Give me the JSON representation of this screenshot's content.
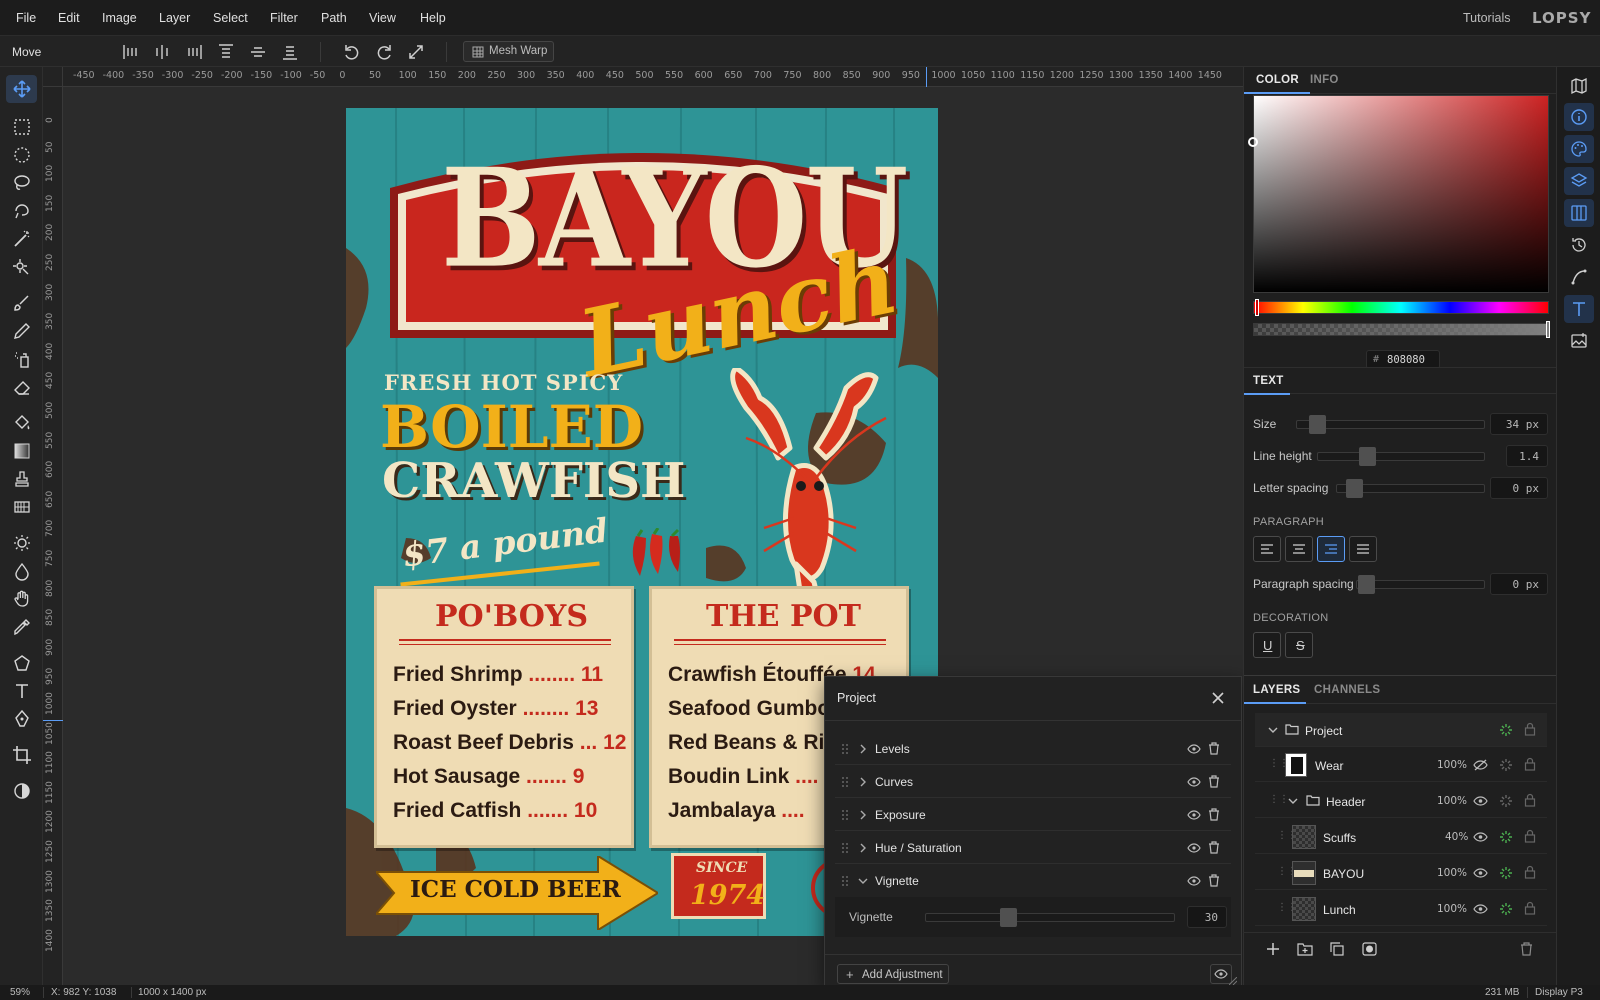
{
  "menubar": {
    "items": [
      "File",
      "Edit",
      "Image",
      "Layer",
      "Select",
      "Filter",
      "Path",
      "View",
      "Help"
    ],
    "tutorials": "Tutorials",
    "logo": "LOPSY"
  },
  "toolbar": {
    "tool_name": "Move",
    "mesh_warp": "Mesh Warp"
  },
  "rulers": {
    "top": [
      "-450",
      "-400",
      "-350",
      "-300",
      "-250",
      "-200",
      "-150",
      "-100",
      "-50",
      "0",
      "50",
      "100",
      "150",
      "200",
      "250",
      "300",
      "350",
      "400",
      "450",
      "500",
      "550",
      "600",
      "650",
      "700",
      "750",
      "800",
      "850",
      "900",
      "950",
      "1000",
      "1050",
      "1100",
      "1150",
      "1200",
      "1250",
      "1300",
      "1350",
      "1400",
      "1450"
    ],
    "left": [
      "0",
      "50",
      "100",
      "150",
      "200",
      "250",
      "300",
      "350",
      "400",
      "450",
      "500",
      "550",
      "600",
      "650",
      "700",
      "750",
      "800",
      "850",
      "900",
      "950",
      "1000",
      "1050",
      "1100",
      "1150",
      "1200",
      "1250",
      "1300",
      "1350",
      "1400"
    ]
  },
  "poster": {
    "title": "BAYOU",
    "subtitle": "Lunch",
    "tagline": "FRESH HOT SPICY",
    "headline1": "BOILED",
    "headline2": "CRAWFISH",
    "price": "$7 a pound",
    "poboys": {
      "title": "PO'BOYS",
      "items": [
        {
          "name": "Fried Shrimp",
          "dots": "........",
          "price": "11"
        },
        {
          "name": "Fried Oyster",
          "dots": "........",
          "price": "13"
        },
        {
          "name": "Roast Beef Debris",
          "dots": "...",
          "price": "12"
        },
        {
          "name": "Hot Sausage",
          "dots": ".......",
          "price": "9"
        },
        {
          "name": "Fried Catfish",
          "dots": ".......",
          "price": "10"
        }
      ]
    },
    "pot": {
      "title": "THE POT",
      "items": [
        {
          "name": "Crawfish Étouffée",
          "price": "14"
        },
        {
          "name": "Seafood Gumbo",
          "price": ""
        },
        {
          "name": "Red Beans & Rice",
          "price": ""
        },
        {
          "name": "Boudin Link",
          "dots": "....",
          "price": ""
        },
        {
          "name": "Jambalaya",
          "dots": "....",
          "price": ""
        }
      ]
    },
    "beer": "ICE COLD BEER",
    "since_label": "SINCE",
    "since_year": "1974"
  },
  "color_panel": {
    "tabs": [
      "COLOR",
      "INFO"
    ],
    "hex_prefix": "#",
    "hex": "808080",
    "hue_base": "#cc2222"
  },
  "text_panel": {
    "title": "TEXT",
    "size_label": "Size",
    "size_value": "34 px",
    "line_height_label": "Line height",
    "line_height_value": "1.4",
    "letter_spacing_label": "Letter spacing",
    "letter_spacing_value": "0 px",
    "paragraph_label": "PARAGRAPH",
    "paragraph_spacing_label": "Paragraph spacing",
    "paragraph_spacing_value": "0 px",
    "decoration_label": "DECORATION"
  },
  "layers_panel": {
    "tabs": [
      "LAYERS",
      "CHANNELS"
    ],
    "layers": [
      {
        "name": "Project",
        "opacity": ""
      },
      {
        "name": "Wear",
        "opacity": "100%"
      },
      {
        "name": "Header",
        "opacity": "100%"
      },
      {
        "name": "Scuffs",
        "opacity": "40%"
      },
      {
        "name": "BAYOU",
        "opacity": "100%"
      },
      {
        "name": "Lunch",
        "opacity": "100%"
      }
    ]
  },
  "dialog": {
    "title": "Project",
    "adjustments": [
      "Levels",
      "Curves",
      "Exposure",
      "Hue / Saturation",
      "Vignette"
    ],
    "vignette_label": "Vignette",
    "vignette_value": "30",
    "add_button": "Add Adjustment"
  },
  "status": {
    "zoom": "59%",
    "cursor": "X: 982 Y: 1038",
    "doc_size": "1000 x 1400 px",
    "memory": "231 MB",
    "profile": "Display P3"
  }
}
